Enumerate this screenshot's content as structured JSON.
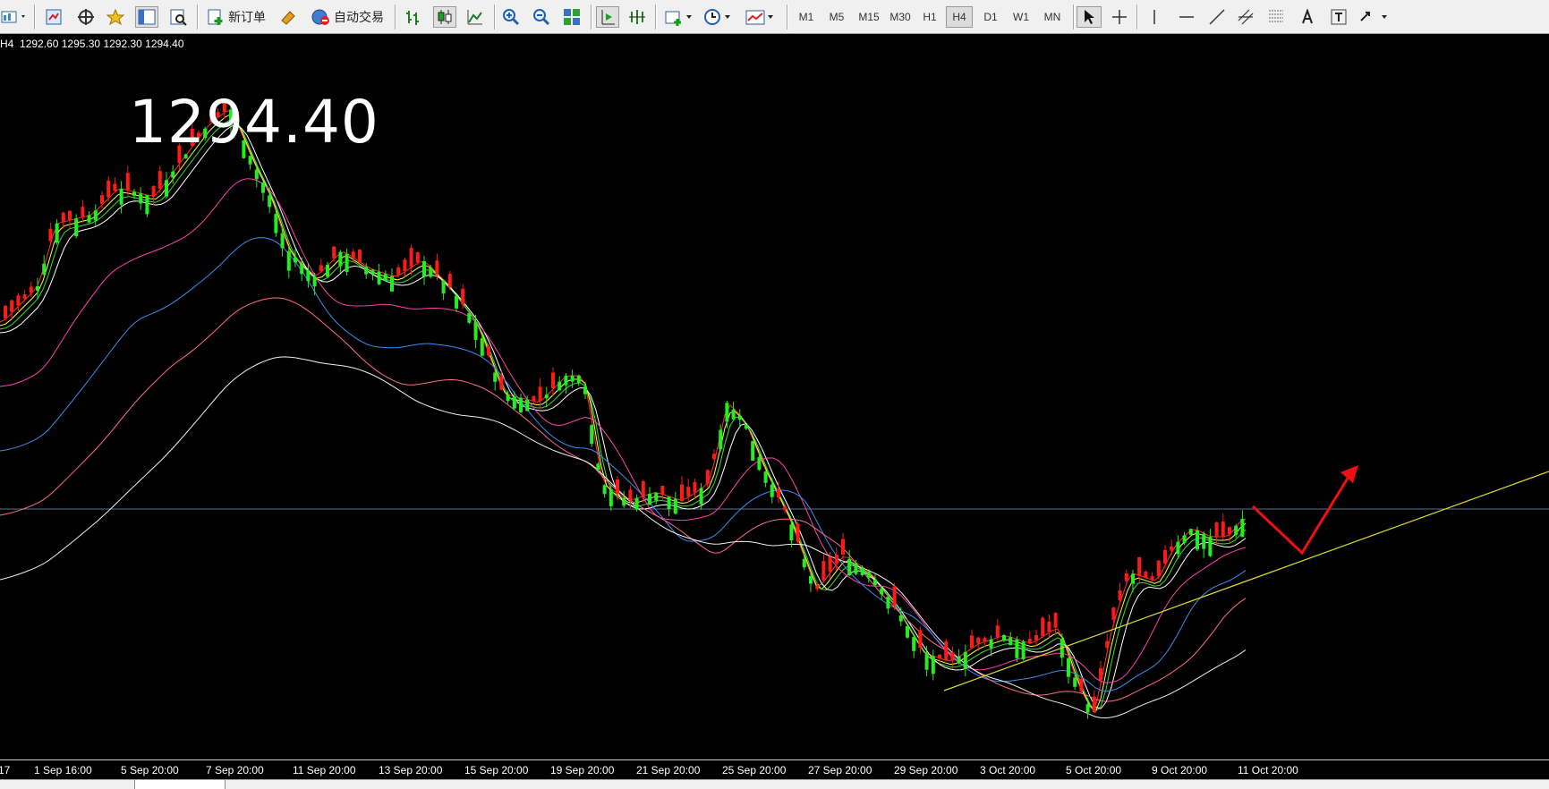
{
  "toolbar": {
    "new_order": "新订单",
    "auto_trading": "自动交易",
    "timeframes": [
      "M1",
      "M5",
      "M15",
      "M30",
      "H1",
      "H4",
      "D1",
      "W1",
      "MN"
    ],
    "active_timeframe": "H4",
    "icons": [
      "new-chart-icon",
      "profiles-icon",
      "market-watch-icon",
      "navigator-icon",
      "favorites-icon",
      "data-window-icon",
      "strategy-tester-icon",
      "new-order-icon",
      "metaeditor-icon",
      "auto-trading-icon",
      "bar-chart-icon",
      "candlestick-icon",
      "line-chart-icon",
      "zoom-in-icon",
      "zoom-out-icon",
      "tile-windows-icon",
      "auto-scroll-icon",
      "chart-shift-icon",
      "indicators-icon",
      "periods-icon",
      "templates-icon",
      "cursor-icon",
      "crosshair-icon",
      "vertical-line-icon",
      "horizontal-line-icon",
      "trendline-icon",
      "equidistant-channel-icon",
      "fibonacci-icon",
      "text-icon",
      "text-label-icon",
      "arrows-icon"
    ]
  },
  "chart": {
    "timeframe_label": "H4",
    "ohlc": "1292.60 1295.30 1292.30 1294.40",
    "big_price": "1294.40",
    "colors": {
      "bull": "#ff1a1a",
      "bear": "#22ee22",
      "background": "#000000",
      "bid_line": "#5b6f8f"
    }
  },
  "xaxis_labels": [
    "17",
    "1 Sep 16:00",
    "5 Sep 20:00",
    "7 Sep 20:00",
    "11 Sep 20:00",
    "13 Sep 20:00",
    "15 Sep 20:00",
    "19 Sep 20:00",
    "21 Sep 20:00",
    "25 Sep 20:00",
    "27 Sep 20:00",
    "29 Sep 20:00",
    "3 Oct 20:00",
    "5 Oct 20:00",
    "9 Oct 20:00",
    "11 Oct 20:00"
  ]
}
